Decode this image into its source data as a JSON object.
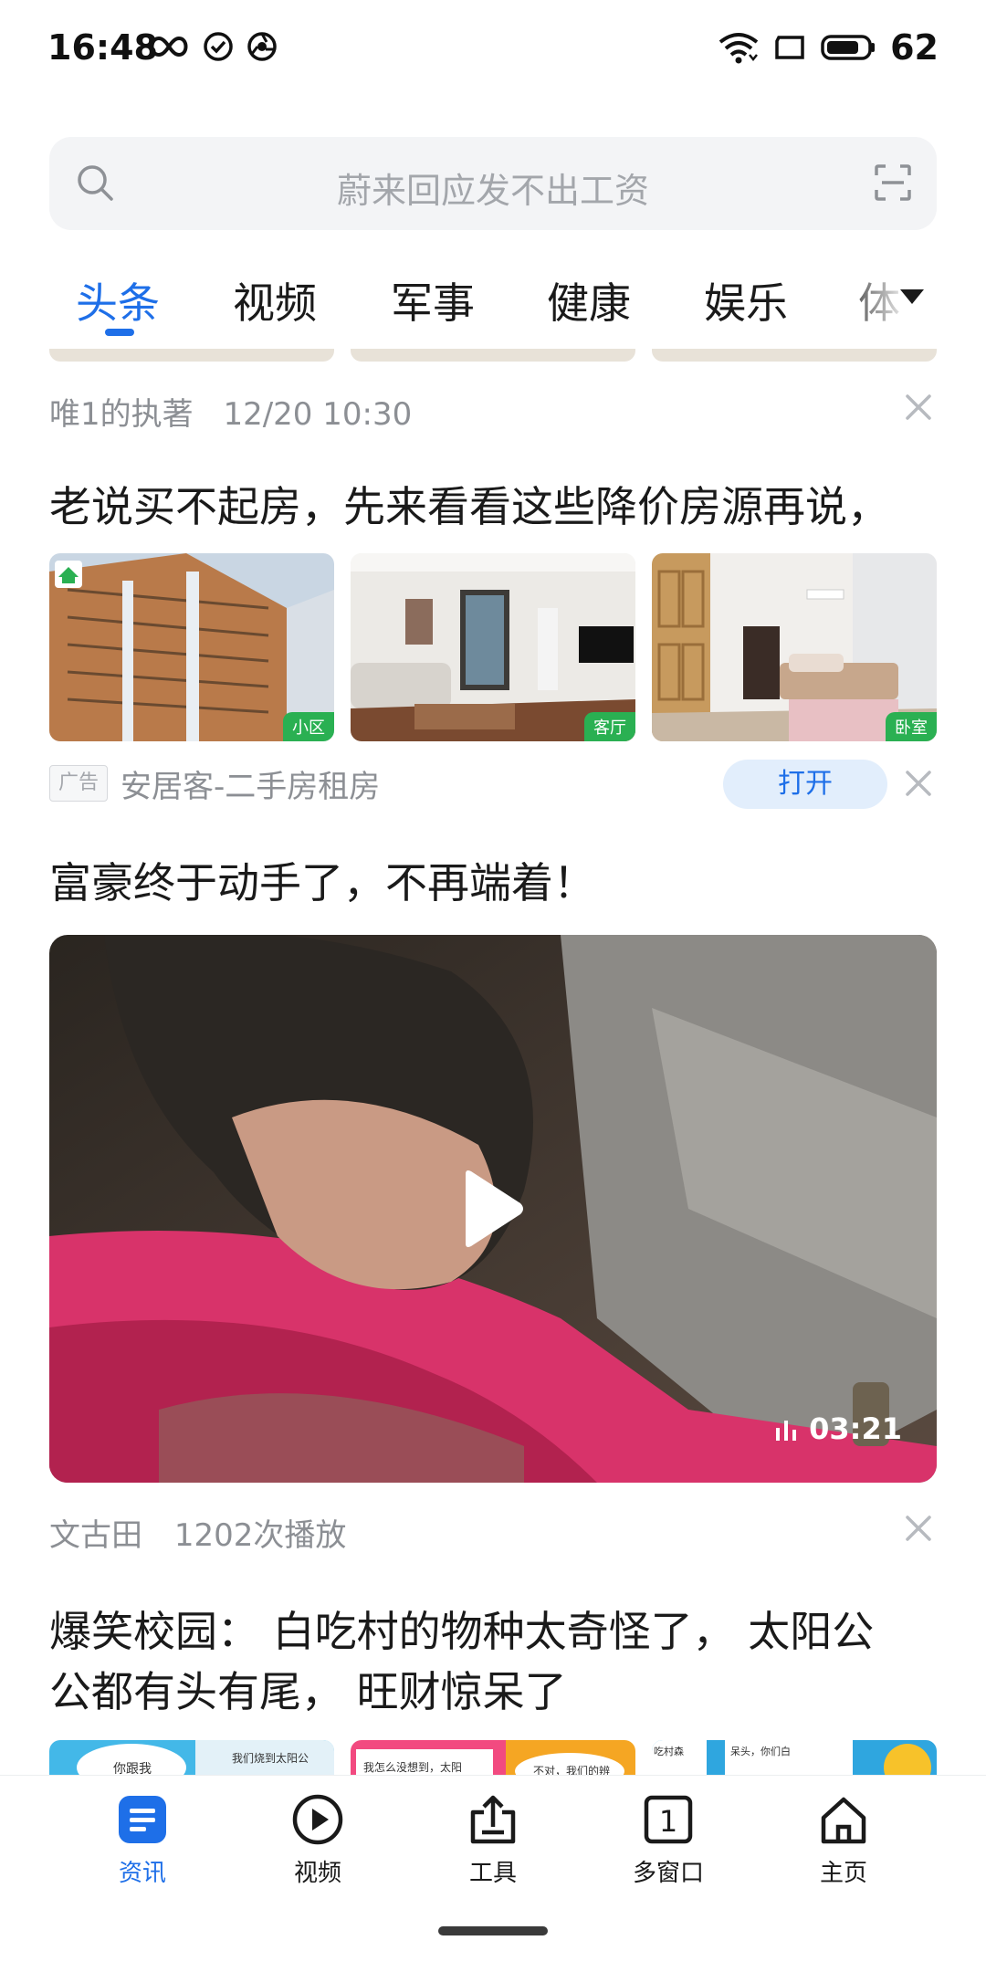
{
  "status_bar": {
    "time": "16:48",
    "battery": "62"
  },
  "search": {
    "placeholder": "蔚来回应发不出工资"
  },
  "tabs": [
    {
      "label": "头条",
      "active": true
    },
    {
      "label": "视频"
    },
    {
      "label": "军事"
    },
    {
      "label": "健康"
    },
    {
      "label": "娱乐"
    },
    {
      "label": "体"
    }
  ],
  "feed": {
    "item1_meta": {
      "author": "唯1的执著",
      "time": "12/20 10:30"
    },
    "ad": {
      "title": "老说买不起房，先来看看这些降价房源再说，",
      "thumbs": [
        {
          "tag": "小区",
          "logo": "Anjuke"
        },
        {
          "tag": "客厅"
        },
        {
          "tag": "卧室"
        }
      ],
      "badge": "广告",
      "source": "安居客-二手房租房",
      "button": "打开"
    },
    "video": {
      "title": "富豪终于动手了，不再端着！",
      "duration": "03:21",
      "author": "文古田",
      "plays": "1202次播放"
    },
    "article": {
      "title_line1": "爆笑校园： 白吃村的物种太奇怪了， 太阳公",
      "title_line2": "公都有头有尾， 旺财惊呆了",
      "comic_snippets": [
        "你跟我",
        "我们烧到太阳公",
        "我怎么没想到，太阳",
        "不对，我们的辨",
        "吃村森",
        "呆头，你们白"
      ]
    }
  },
  "bottom_nav": [
    {
      "label": "资讯",
      "icon": "news-icon",
      "active": true
    },
    {
      "label": "视频",
      "icon": "play-circle-icon"
    },
    {
      "label": "工具",
      "icon": "toolbox-icon"
    },
    {
      "label": "多窗口",
      "icon": "window-count-icon",
      "count": "1"
    },
    {
      "label": "主页",
      "icon": "home-icon"
    }
  ],
  "colors": {
    "accent": "#1e6fe8",
    "tag_green": "#2ab052"
  }
}
